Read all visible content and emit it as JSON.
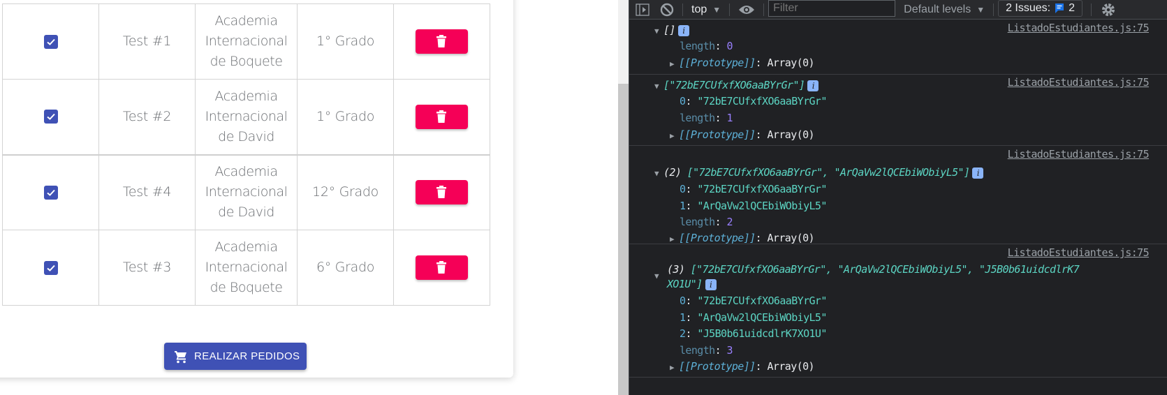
{
  "students_table": {
    "rows": [
      {
        "checked": true,
        "name": "Test #1",
        "school_lines": [
          "Academia",
          "Internacional",
          "de Boquete"
        ],
        "grade": "1° Grado"
      },
      {
        "checked": true,
        "name": "Test #2",
        "school_lines": [
          "Academia",
          "Internacional",
          "de David"
        ],
        "grade": "1° Grado"
      },
      {
        "checked": true,
        "name": "Test #4",
        "school_lines": [
          "Academia",
          "Internacional",
          "de David"
        ],
        "grade": "12° Grado"
      },
      {
        "checked": true,
        "name": "Test #3",
        "school_lines": [
          "Academia",
          "Internacional",
          "de Boquete"
        ],
        "grade": "6° Grado"
      }
    ],
    "delete_icon": "trash-icon"
  },
  "order_button": {
    "label": "REALIZAR PEDIDOS",
    "icon": "cart-icon"
  },
  "colors": {
    "primary": "#3f51b5",
    "danger": "#f50057",
    "devtools_bg": "#202124"
  },
  "devtools": {
    "toolbar": {
      "context": "top",
      "filter_placeholder": "Filter",
      "levels": "Default levels",
      "issues_label": "2 Issues:",
      "issues_count": "2"
    },
    "console": [
      {
        "source": "ListadoEstudiantes.js:75",
        "summary_prefix": "",
        "summary": "[]",
        "items": [],
        "length_key": "length",
        "length": "0",
        "proto_key": "[[Prototype]]",
        "proto_val": "Array(0)"
      },
      {
        "source": "ListadoEstudiantes.js:75",
        "summary_prefix": "",
        "summary": "[\"72bE7CUfxfXO6aaBYrGr\"]",
        "items": [
          {
            "key": "0",
            "value": "\"72bE7CUfxfXO6aaBYrGr\""
          }
        ],
        "length_key": "length",
        "length": "1",
        "proto_key": "[[Prototype]]",
        "proto_val": "Array(0)"
      },
      {
        "source": "ListadoEstudiantes.js:75",
        "summary_prefix": "(2)",
        "summary": "[\"72bE7CUfxfXO6aaBYrGr\", \"ArQaVw2lQCEbiWObiyL5\"]",
        "items": [
          {
            "key": "0",
            "value": "\"72bE7CUfxfXO6aaBYrGr\""
          },
          {
            "key": "1",
            "value": "\"ArQaVw2lQCEbiWObiyL5\""
          }
        ],
        "length_key": "length",
        "length": "2",
        "proto_key": "[[Prototype]]",
        "proto_val": "Array(0)"
      },
      {
        "source": "ListadoEstudiantes.js:75",
        "summary_prefix": "(3)",
        "summary_line1": "[\"72bE7CUfxfXO6aaBYrGr\", \"ArQaVw2lQCEbiWObiyL5\", \"J5B0b61uidcdlrK7",
        "summary_line2": "XO1U\"]",
        "items": [
          {
            "key": "0",
            "value": "\"72bE7CUfxfXO6aaBYrGr\""
          },
          {
            "key": "1",
            "value": "\"ArQaVw2lQCEbiWObiyL5\""
          },
          {
            "key": "2",
            "value": "\"J5B0b61uidcdlrK7XO1U\""
          }
        ],
        "length_key": "length",
        "length": "3",
        "proto_key": "[[Prototype]]",
        "proto_val": "Array(0)"
      }
    ]
  }
}
